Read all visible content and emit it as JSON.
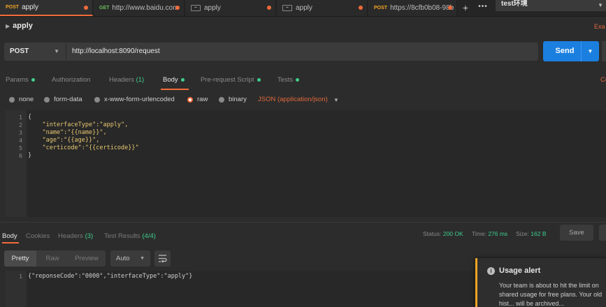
{
  "tabs": [
    {
      "method": "POST",
      "title": "apply",
      "unsaved": true,
      "active": true
    },
    {
      "method": "GET",
      "title": "http://www.baidu.com",
      "unsaved": true,
      "active": false
    },
    {
      "method": "",
      "title": "apply",
      "unsaved": true,
      "active": false,
      "icon": "doc-icon"
    },
    {
      "method": "",
      "title": "apply",
      "unsaved": true,
      "active": false,
      "icon": "doc-icon"
    },
    {
      "method": "POST",
      "title": "https://8cfb0b08-98b",
      "unsaved": true,
      "active": false
    }
  ],
  "tab_controls": {
    "add": "+",
    "more": "•••"
  },
  "environment": {
    "selected": "test环境"
  },
  "request": {
    "title": "apply",
    "examples_link": "Exa",
    "method": "POST",
    "url": "http://localhost:8090/request",
    "send_label": "Send"
  },
  "request_tabs": [
    {
      "label": "Params",
      "dot": true
    },
    {
      "label": "Authorization"
    },
    {
      "label": "Headers",
      "count": "(1)"
    },
    {
      "label": "Body",
      "dot": true,
      "active": true
    },
    {
      "label": "Pre-request Script",
      "dot": true
    },
    {
      "label": "Tests",
      "dot": true
    }
  ],
  "cookies_link": "Co",
  "body_types": [
    {
      "label": "none",
      "selected": false
    },
    {
      "label": "form-data",
      "selected": false
    },
    {
      "label": "x-www-form-urlencoded",
      "selected": false
    },
    {
      "label": "raw",
      "selected": true
    },
    {
      "label": "binary",
      "selected": false
    }
  ],
  "raw_type": "JSON (application/json)",
  "editor": {
    "line_numbers": [
      "1",
      "2",
      "3",
      "4",
      "5",
      "6"
    ],
    "lines": [
      "{",
      "    \"interfaceType\":\"apply\",",
      "    \"name\":\"{{name}}\",",
      "    \"age\":\"{{age}}\",",
      "    \"certicode\":\"{{certicode}}\"",
      "}"
    ]
  },
  "response_tabs": [
    {
      "label": "Body",
      "active": true
    },
    {
      "label": "Cookies"
    },
    {
      "label": "Headers",
      "count": "(3)"
    },
    {
      "label": "Test Results",
      "count": "(4/4)"
    }
  ],
  "response_status": {
    "status_label": "Status:",
    "status_value": "200 OK",
    "time_label": "Time:",
    "time_value": "276 ms",
    "size_label": "Size:",
    "size_value": "162 B"
  },
  "response_save_label": "Save",
  "response_format": {
    "modes": [
      "Pretty",
      "Raw",
      "Preview"
    ],
    "active_mode": "Pretty",
    "language": "Auto"
  },
  "response_body": {
    "line_numbers": [
      "1"
    ],
    "lines": [
      "{\"reponseCode\":\"0000\",\"interfaceType\":\"apply\"}"
    ]
  },
  "alert": {
    "icon": "info-icon",
    "title": "Usage alert",
    "lines": [
      "Your team is about to hit the limit on",
      "shared usage for free plans. Your old",
      "hist... will be archived..."
    ]
  },
  "colors": {
    "accent": "#f26b3a",
    "send_button": "#1b7fe0",
    "success": "#3ecf8e",
    "post_method": "#f5a623",
    "get_method": "#6bbd5b"
  }
}
